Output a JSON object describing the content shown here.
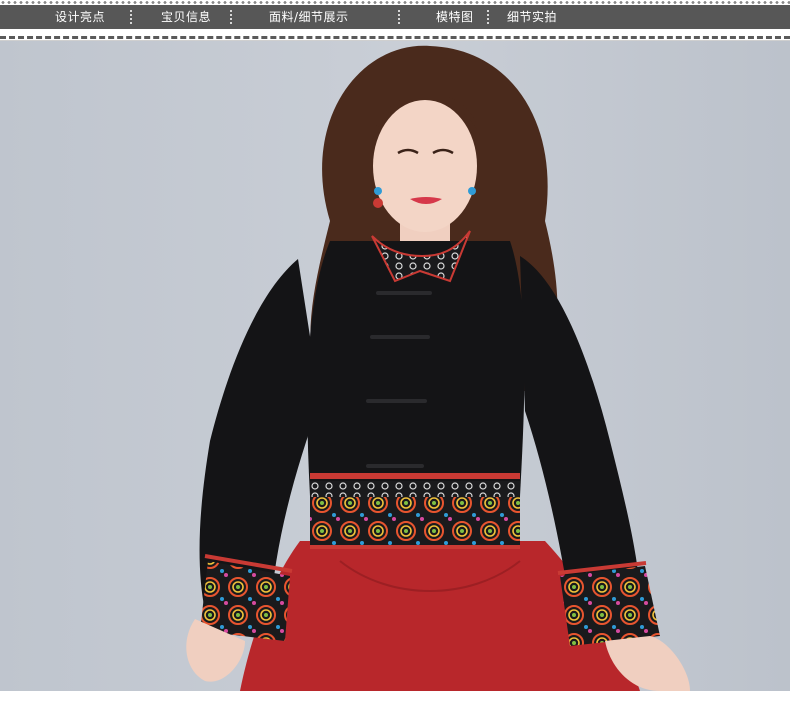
{
  "nav": {
    "items": [
      {
        "label": "设计亮点"
      },
      {
        "label": "宝贝信息"
      },
      {
        "label": "面料/细节展示"
      },
      {
        "label": "模特图",
        "active": true
      },
      {
        "label": "细节实拍"
      }
    ],
    "bar_color": "#575757",
    "active_marker_color": "#f1a91d"
  },
  "photo": {
    "subject": "model-wearing-black-embroidered-jacket",
    "colors": {
      "background": "#c4c9d1",
      "jacket": "#141416",
      "skirt": "#b8272b",
      "hair": "#4a2a1c"
    }
  }
}
